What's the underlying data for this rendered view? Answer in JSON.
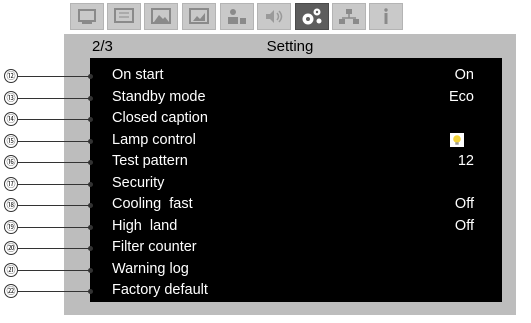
{
  "tabs": [
    {
      "icon": "display-icon",
      "active": false
    },
    {
      "icon": "screen-adjust-icon",
      "active": false
    },
    {
      "icon": "image-icon",
      "active": false
    },
    {
      "icon": "image-adjust-icon",
      "active": false
    },
    {
      "icon": "install-icon",
      "active": false
    },
    {
      "icon": "sound-icon",
      "active": false
    },
    {
      "icon": "settings-gears-icon",
      "active": true
    },
    {
      "icon": "network-icon",
      "active": false
    },
    {
      "icon": "info-icon",
      "active": false
    }
  ],
  "header": {
    "page": "2/3",
    "title": "Setting"
  },
  "menu": [
    {
      "num": "⑫",
      "label": "On start",
      "value": "On"
    },
    {
      "num": "⑬",
      "label": "Standby mode",
      "value": "Eco"
    },
    {
      "num": "⑭",
      "label": "Closed caption",
      "value": ""
    },
    {
      "num": "⑮",
      "label": "Lamp control",
      "value": "",
      "icon": "lamp-bulb-icon"
    },
    {
      "num": "⑯",
      "label": "Test pattern",
      "value": "12"
    },
    {
      "num": "⑰",
      "label": "Security",
      "value": ""
    },
    {
      "num": "⑱",
      "label": "Cooling  fast",
      "value": "Off"
    },
    {
      "num": "⑲",
      "label": "High  land",
      "value": "Off"
    },
    {
      "num": "⑳",
      "label": "Filter counter",
      "value": ""
    },
    {
      "num": "㉑",
      "label": "Warning log",
      "value": ""
    },
    {
      "num": "㉒",
      "label": "Factory default",
      "value": ""
    }
  ],
  "colors": {
    "panel": "#bdbdbd",
    "screen": "#000000",
    "tab": "#c9c9c9",
    "tab_active": "#5d5d5d",
    "bulb": "#f2d23a"
  }
}
